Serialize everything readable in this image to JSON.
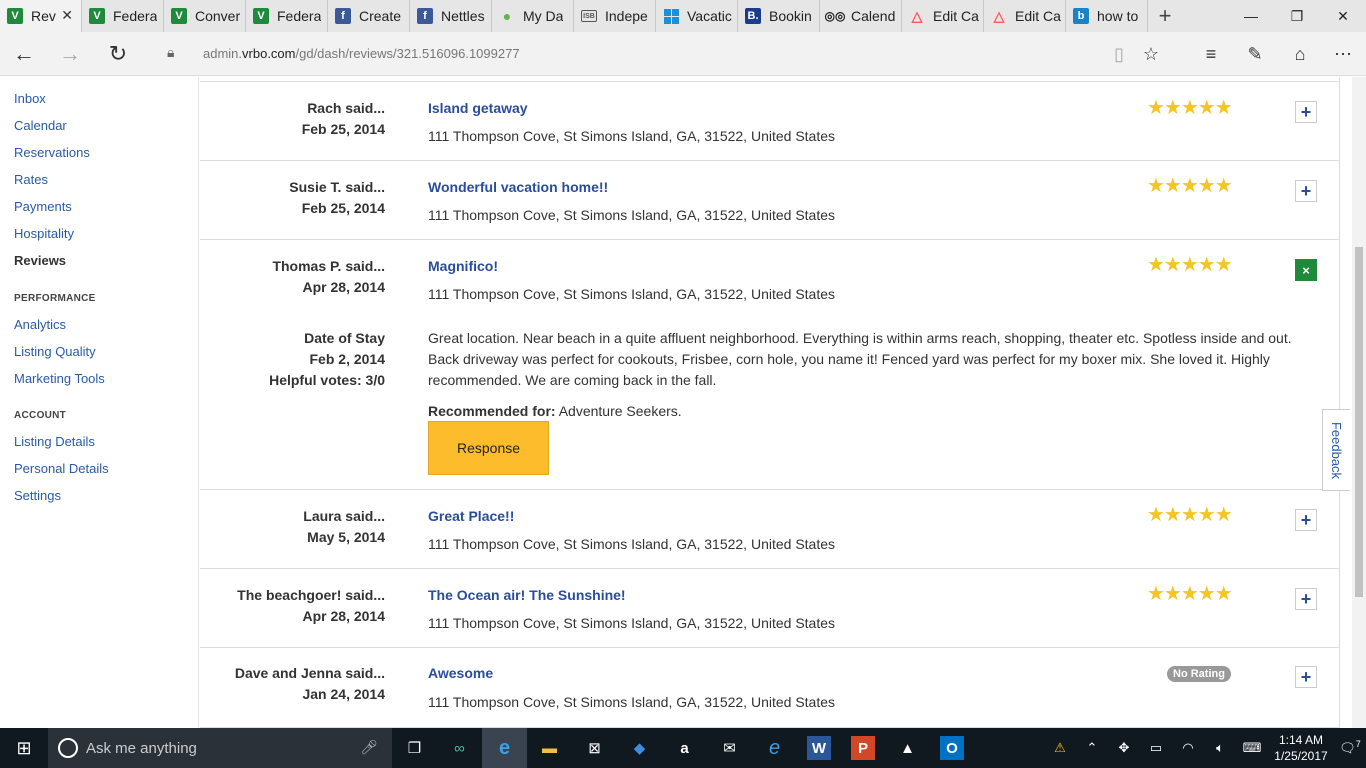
{
  "browser": {
    "tabs": [
      {
        "label": "Rev",
        "favicon": "vrbo-v-icon",
        "active": true
      },
      {
        "label": "Federa",
        "favicon": "vrbo-v-icon"
      },
      {
        "label": "Conver",
        "favicon": "vrbo-v-icon"
      },
      {
        "label": "Federa",
        "favicon": "vrbo-v-icon"
      },
      {
        "label": "Create",
        "favicon": "facebook-icon"
      },
      {
        "label": "Nettles",
        "favicon": "facebook-icon"
      },
      {
        "label": "My Da",
        "favicon": "map-pin-icon"
      },
      {
        "label": "Indepe",
        "favicon": "independence-icon"
      },
      {
        "label": "Vacatic",
        "favicon": "vacasa-icon"
      },
      {
        "label": "Bookin",
        "favicon": "booking-icon"
      },
      {
        "label": "Calend",
        "favicon": "tripadvisor-icon"
      },
      {
        "label": "Edit Ca",
        "favicon": "airbnb-icon"
      },
      {
        "label": "Edit Ca",
        "favicon": "airbnb-icon"
      },
      {
        "label": "how to",
        "favicon": "bing-icon"
      }
    ],
    "url_prefix": "admin.",
    "url_domain": "vrbo.com",
    "url_path": "/gd/dash/reviews/321.516096.1099277"
  },
  "sidebar": {
    "items_top": [
      "Inbox",
      "Calendar",
      "Reservations",
      "Rates",
      "Payments",
      "Hospitality",
      "Reviews"
    ],
    "performance_heading": "PERFORMANCE",
    "items_performance": [
      "Analytics",
      "Listing Quality",
      "Marketing Tools"
    ],
    "account_heading": "ACCOUNT",
    "items_account": [
      "Listing Details",
      "Personal Details",
      "Settings"
    ]
  },
  "reviews": [
    {
      "reviewer": "Rach said...",
      "date": "Feb 25, 2014",
      "title": "Island getaway",
      "address": "111 Thompson Cove, St Simons Island, GA, 31522, United States",
      "rating": "★★★★★",
      "toggle": "+"
    },
    {
      "reviewer": "Susie T. said...",
      "date": "Feb 25, 2014",
      "title": "Wonderful vacation home!!",
      "address": "111 Thompson Cove, St Simons Island, GA, 31522, United States",
      "rating": "★★★★★",
      "toggle": "+"
    },
    {
      "reviewer": "Thomas P. said...",
      "date": "Apr 28, 2014",
      "title": "Magnifico!",
      "address": "111 Thompson Cove, St Simons Island, GA, 31522, United States",
      "rating": "★★★★★",
      "toggle": "×"
    },
    {
      "reviewer": "Laura said...",
      "date": "May 5, 2014",
      "title": "Great Place!!",
      "address": "111 Thompson Cove, St Simons Island, GA, 31522, United States",
      "rating": "★★★★★",
      "toggle": "+"
    },
    {
      "reviewer": "The beachgoer! said...",
      "date": "Apr 28, 2014",
      "title": "The Ocean air! The Sunshine!",
      "address": "111 Thompson Cove, St Simons Island, GA, 31522, United States",
      "rating": "★★★★★",
      "toggle": "+"
    },
    {
      "reviewer": "Dave and Jenna said...",
      "date": "Jan 24, 2014",
      "title": "Awesome",
      "address": "111 Thompson Cove, St Simons Island, GA, 31522, United States",
      "no_rating": "No Rating",
      "toggle": "+"
    }
  ],
  "expanded": {
    "date_of_stay_label": "Date of Stay",
    "date_of_stay": "Feb 2, 2014",
    "helpful_votes": "Helpful votes: 3/0",
    "text": "Great location. Near beach in a quite affluent neighborhood. Everything is within arms reach, shopping, theater etc. Spotless inside and out. Back driveway was perfect for cookouts, Frisbee, corn hole, you name it! Fenced yard was perfect for my boxer mix. She loved it. Highly recommended. We are coming back in the fall.",
    "recommended_label": "Recommended for:",
    "recommended_value": " Adventure Seekers.",
    "response_button": "Response"
  },
  "feedback_tab": "Feedback",
  "taskbar": {
    "search_placeholder": "Ask me anything",
    "time": "1:14 AM",
    "date": "1/25/2017",
    "notifications": "7"
  },
  "colors": {
    "star": "#f3c623",
    "link": "#2a4d9b",
    "response_button": "#fdbc2c",
    "expanded_toggle": "#1f8a3c"
  }
}
